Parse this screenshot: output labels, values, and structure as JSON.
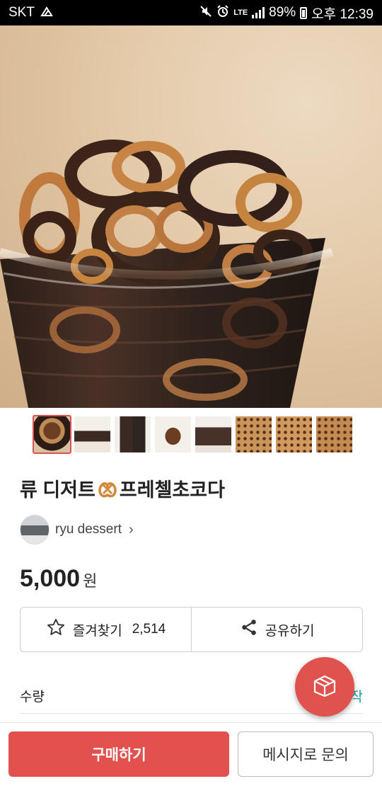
{
  "status_bar": {
    "carrier": "SKT",
    "network": "LTE",
    "battery": "89%",
    "time": "오후 12:39",
    "icons": [
      "sync-icon",
      "mute-icon",
      "alarm-icon",
      "signal-icon",
      "battery-icon"
    ]
  },
  "gallery": {
    "active_index": 0,
    "thumbnail_count": 8
  },
  "product": {
    "title_before": "류 디저트",
    "title_after": "프레첼초코다",
    "title_emoji_icon": "pretzel-icon"
  },
  "seller": {
    "name": "ryu dessert",
    "chevron": "›"
  },
  "price": {
    "value": "5,000",
    "unit": "원"
  },
  "actions": {
    "favorite_label": "즐겨찾기",
    "favorite_count": "2,514",
    "share_label": "공유하기"
  },
  "quantity": {
    "label": "수량",
    "right_partial": "작"
  },
  "fab": {
    "icon": "box-icon"
  },
  "bottom": {
    "buy_label": "구매하기",
    "message_label": "메시지로 문의"
  },
  "colors": {
    "accent": "#e2514e",
    "teal": "#1a9e9e"
  }
}
